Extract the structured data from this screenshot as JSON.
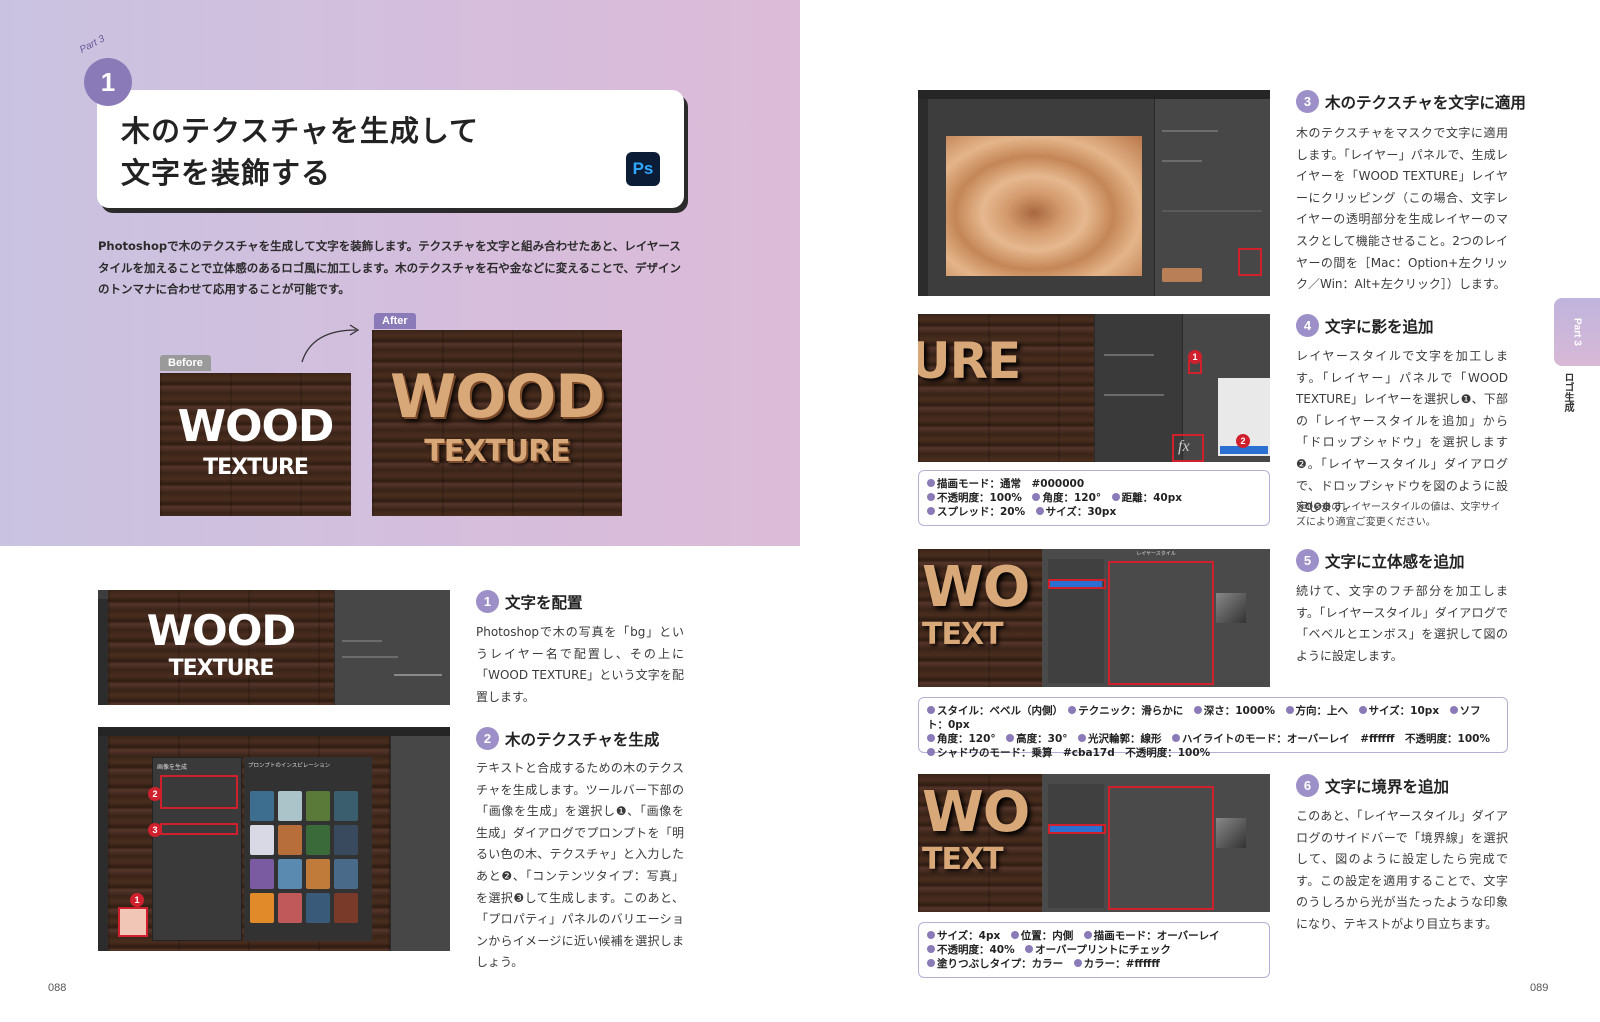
{
  "header": {
    "part_label": "Part 3",
    "number": "1",
    "title": "木のテクスチャを生成して\n文字を装飾する",
    "app_icon": "Ps"
  },
  "intro": "Photoshopで木のテクスチャを生成して文字を装飾します。テクスチャを文字と組み合わせたあと、レイヤースタイルを加えることで立体感のあるロゴ風に加工します。木のテクスチャを石や金などに変えることで、デザインのトンマナに合わせて応用することが可能です。",
  "before_after": {
    "before_label": "Before",
    "after_label": "After",
    "text_line1": "WOOD",
    "text_line2": "TEXTURE"
  },
  "steps": [
    {
      "num": "1",
      "title": "文字を配置",
      "body": "Photoshopで木の写真を「bg」というレイヤー名で配置し、その上に「WOOD TEXTURE」という文字を配置します。"
    },
    {
      "num": "2",
      "title": "木のテクスチャを生成",
      "body": "テキストと合成するための木のテクスチャを生成します。ツールバー下部の「画像を生成」を選択し❶、「画像を生成」ダイアログでプロンプトを「明るい色の木、テクスチャ」と入力したあと❷、「コンテンツタイプ：写真」を選択❸して生成します。このあと、「プロパティ」パネルのバリエーションからイメージに近い候補を選択しましょう。"
    },
    {
      "num": "3",
      "title": "木のテクスチャを文字に適用",
      "body": "木のテクスチャをマスクで文字に適用します。「レイヤー」パネルで、生成レイヤーを「WOOD TEXTURE」レイヤーにクリッピング（この場合、文字レイヤーの透明部分を生成レイヤーのマスクとして機能させること。2つのレイヤーの間を［Mac：Option+左クリック／Win：Alt+左クリック］）します。"
    },
    {
      "num": "4",
      "title": "文字に影を追加",
      "body": "レイヤースタイルで文字を加工します。「レイヤー」パネルで「WOOD TEXTURE」レイヤーを選択し❶、下部の「レイヤースタイルを追加」から「ドロップシャドウ」を選択します❷。「レイヤースタイル」ダイアログで、ドロップシャドウを図のように設定します。",
      "note": "※❹❺❻のレイヤースタイルの値は、文字サイズにより適宜ご変更ください。"
    },
    {
      "num": "5",
      "title": "文字に立体感を追加",
      "body": "続けて、文字のフチ部分を加工します。「レイヤースタイル」ダイアログで「ベベルとエンボス」を選択して図のように設定します。"
    },
    {
      "num": "6",
      "title": "文字に境界を追加",
      "body": "このあと、「レイヤースタイル」ダイアログのサイドバーで「境界線」を選択して、図のように設定したら完成です。この設定を適用することで、文字のうしろから光が当たったような印象になり、テキストがより目立ちます。"
    }
  ],
  "settings": {
    "shadow": [
      "描画モード：通常　#000000",
      "不透明度：100%",
      "角度：120°",
      "距離：40px",
      "スプレッド：20%",
      "サイズ：30px"
    ],
    "bevel": [
      "スタイル：ベベル（内側）",
      "テクニック：滑らかに",
      "深さ：1000%",
      "方向：上へ",
      "サイズ：10px",
      "ソフト：0px",
      "角度：120°",
      "高度：30°",
      "光沢輪郭：線形",
      "ハイライトのモード：オーバーレイ　#ffffff　不透明度：100%",
      "シャドウのモード：乗算　#cba17d　不透明度：100%"
    ],
    "stroke": [
      "サイズ：4px",
      "位置：内側",
      "描画モード：オーバーレイ",
      "不透明度：40%",
      "オーバープリントにチェック",
      "塗りつぶしタイプ：カラー",
      "カラー：#ffffff"
    ]
  },
  "screens": {
    "ss2_dialog_title": "画像を生成",
    "ss2_panel_title": "プロンプトのインスピレーション",
    "ss4_fx": "fx",
    "ss4_text": "URE",
    "ss56_text1": "WO",
    "ss56_text2": "TEXT",
    "ss5_dialog_title": "レイヤースタイル"
  },
  "side": {
    "tab": "Part 3",
    "label": "ロゴ生成"
  },
  "pages": {
    "left": "088",
    "right": "089"
  },
  "colors": {
    "accent": "#8a7bb8",
    "red": "#d0202e",
    "ps_blue": "#31a8ff"
  }
}
